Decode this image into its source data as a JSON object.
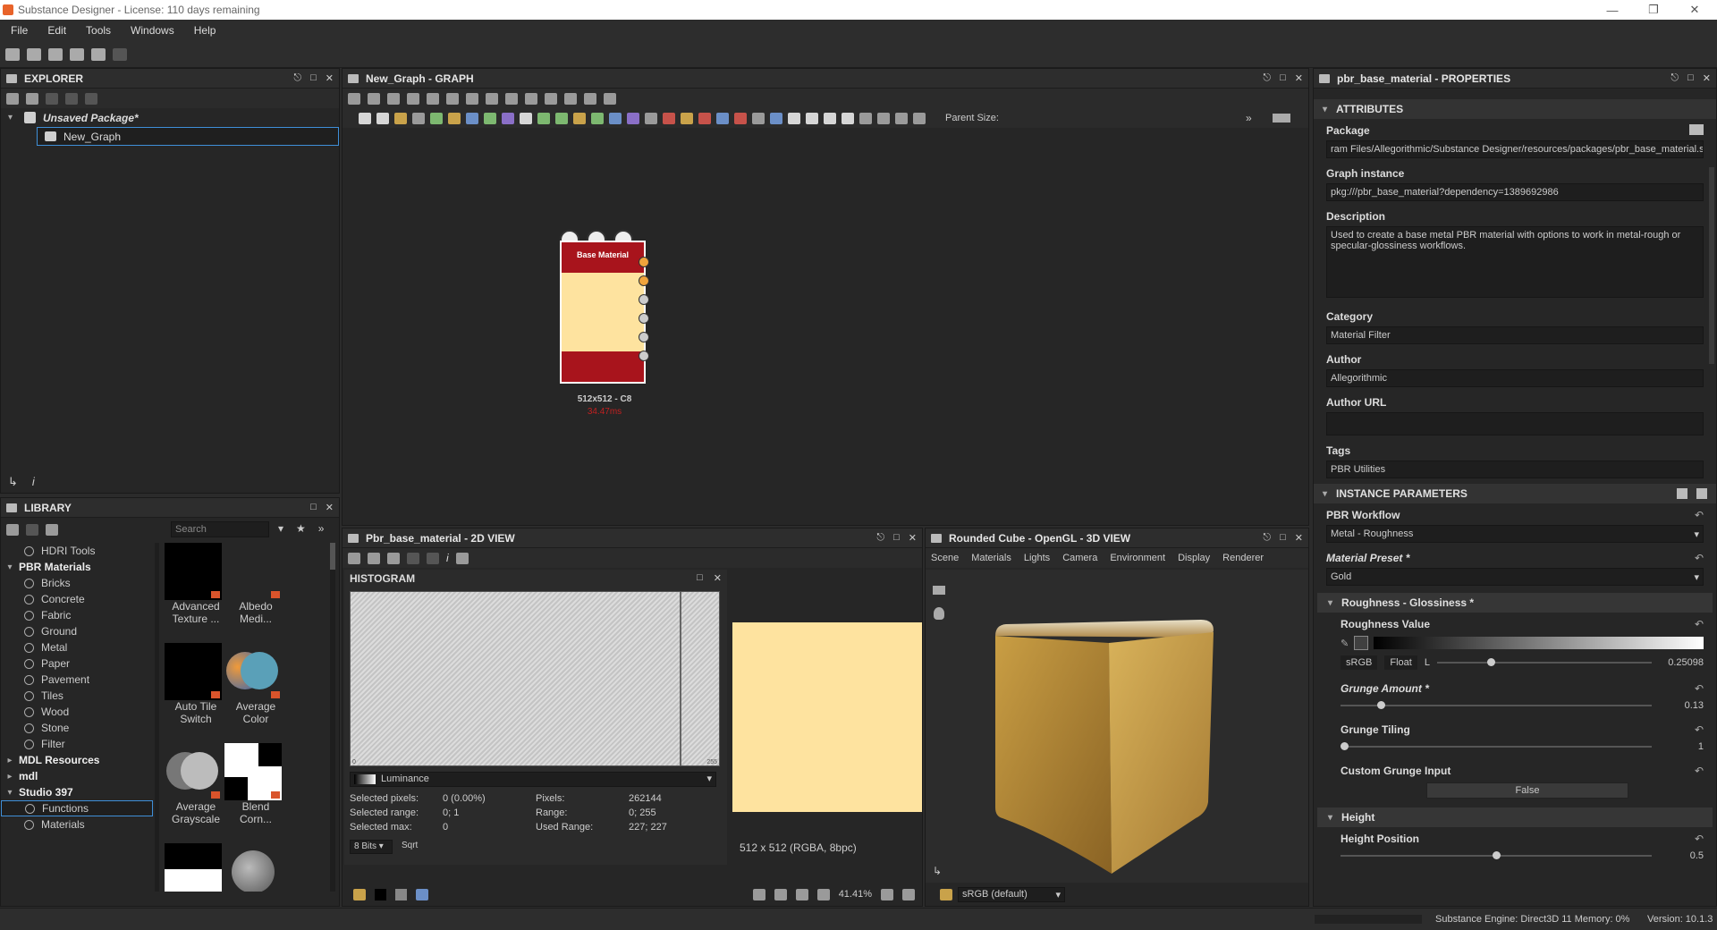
{
  "window": {
    "title": "Substance Designer - License: 110 days remaining"
  },
  "menu": [
    "File",
    "Edit",
    "Tools",
    "Windows",
    "Help"
  ],
  "explorer": {
    "title": "EXPLORER",
    "package": "Unsaved Package*",
    "graph": "New_Graph"
  },
  "graph": {
    "title": "New_Graph - GRAPH",
    "parent_size_label": "Parent Size:",
    "node": {
      "title": "Base Material",
      "size": "512x512 - C8",
      "time": "34.47ms"
    }
  },
  "library": {
    "title": "LIBRARY",
    "search_placeholder": "Search",
    "items": [
      {
        "label": "HDRI Tools",
        "type": "item"
      },
      {
        "label": "PBR Materials",
        "type": "group",
        "arrow": "▾"
      },
      {
        "label": "Bricks",
        "type": "item"
      },
      {
        "label": "Concrete",
        "type": "item"
      },
      {
        "label": "Fabric",
        "type": "item"
      },
      {
        "label": "Ground",
        "type": "item"
      },
      {
        "label": "Metal",
        "type": "item"
      },
      {
        "label": "Paper",
        "type": "item"
      },
      {
        "label": "Pavement",
        "type": "item"
      },
      {
        "label": "Tiles",
        "type": "item"
      },
      {
        "label": "Wood",
        "type": "item"
      },
      {
        "label": "Stone",
        "type": "item"
      },
      {
        "label": "Filter",
        "type": "item"
      },
      {
        "label": "MDL Resources",
        "type": "group",
        "arrow": "▸"
      },
      {
        "label": "mdl",
        "type": "group",
        "arrow": "▸"
      },
      {
        "label": "Studio 397",
        "type": "group",
        "arrow": "▾"
      },
      {
        "label": "Functions",
        "type": "item"
      },
      {
        "label": "Materials",
        "type": "item"
      }
    ],
    "thumbs": [
      {
        "l1": "Advanced",
        "l2": "Texture ..."
      },
      {
        "l1": "Albedo",
        "l2": "Medi..."
      },
      {
        "l1": "Auto Tile",
        "l2": "Switch"
      },
      {
        "l1": "Average",
        "l2": "Color"
      },
      {
        "l1": "Average",
        "l2": "Grayscale"
      },
      {
        "l1": "Blend",
        "l2": "Corn..."
      }
    ]
  },
  "view2d": {
    "title": "Pbr_base_material - 2D VIEW",
    "histogram_title": "HISTOGRAM",
    "axis_min": "0",
    "axis_max": "255",
    "channel": "Luminance",
    "stats": {
      "selected_pixels_label": "Selected pixels:",
      "selected_pixels": "0 (0.00%)",
      "pixels_label": "Pixels:",
      "pixels": "262144",
      "selected_range_label": "Selected range:",
      "selected_range": "0; 1",
      "range_label": "Range:",
      "range": "0; 255",
      "selected_max_label": "Selected max:",
      "selected_max": "0",
      "used_range_label": "Used Range:",
      "used_range": "227; 227"
    },
    "bits": "8 Bits",
    "sqrt": "Sqrt",
    "image_info": "512 x 512 (RGBA, 8bpc)",
    "zoom": "41.41%",
    "swatch_color": "#fee39f"
  },
  "view3d": {
    "title": "Rounded Cube - OpenGL - 3D VIEW",
    "menu": [
      "Scene",
      "Materials",
      "Lights",
      "Camera",
      "Environment",
      "Display",
      "Renderer"
    ],
    "colorspace": "sRGB (default)"
  },
  "properties": {
    "title": "pbr_base_material - PROPERTIES",
    "attributes_label": "ATTRIBUTES",
    "package_label": "Package",
    "package": "ram Files/Allegorithmic/Substance Designer/resources/packages/pbr_base_material.sbs",
    "graph_instance_label": "Graph instance",
    "graph_instance": "pkg:///pbr_base_material?dependency=1389692986",
    "description_label": "Description",
    "description": "Used to create a base metal PBR material with options to work in metal-rough or specular-glossiness workflows.",
    "category_label": "Category",
    "category": "Material Filter",
    "author_label": "Author",
    "author": "Allegorithmic",
    "author_url_label": "Author URL",
    "author_url": "",
    "tags_label": "Tags",
    "tags": "PBR Utilities",
    "instance_params_label": "INSTANCE PARAMETERS",
    "workflow_label": "PBR Workflow",
    "workflow": "Metal - Roughness",
    "preset_label": "Material Preset *",
    "preset": "Gold",
    "rough_group": "Roughness - Glossiness *",
    "rough_value_label": "Roughness Value",
    "srgb": "sRGB",
    "float": "Float",
    "l": "L",
    "rough_value": "0.25098",
    "rough_fraction": 0.25098,
    "grunge_amount_label": "Grunge Amount *",
    "grunge_amount": "0.13",
    "grunge_amount_fraction": 0.13,
    "grunge_tiling_label": "Grunge Tiling",
    "grunge_tiling": "1",
    "custom_grunge_label": "Custom Grunge Input",
    "custom_grunge": "False",
    "height_group": "Height",
    "height_position_label": "Height Position",
    "height_position": "0.5",
    "height_fraction": 0.5
  },
  "status": {
    "engine": "Substance Engine: Direct3D 11  Memory: 0%",
    "version": "Version: 10.1.3"
  }
}
